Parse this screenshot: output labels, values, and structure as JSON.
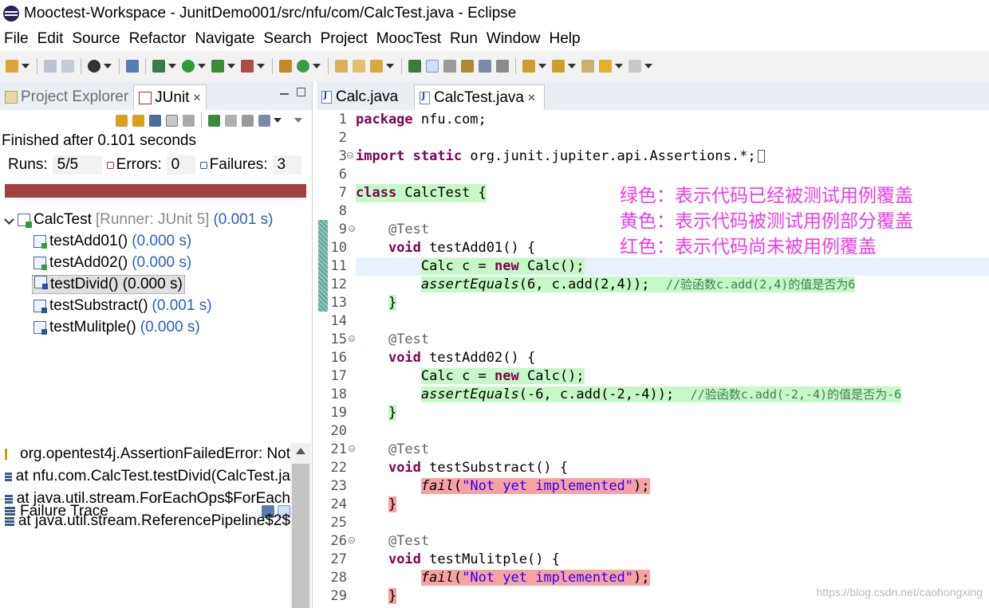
{
  "window": {
    "title": "Mooctest-Workspace - JunitDemo001/src/nfu/com/CalcTest.java - Eclipse"
  },
  "menu": [
    "File",
    "Edit",
    "Source",
    "Refactor",
    "Navigate",
    "Search",
    "Project",
    "MoocTest",
    "Run",
    "Window",
    "Help"
  ],
  "left_panel": {
    "tabs": [
      {
        "label": "Project Explorer"
      },
      {
        "label": "JUnit"
      }
    ],
    "status": "Finished after 0.101 seconds",
    "counters": {
      "runs_label": "Runs:",
      "runs": "5/5",
      "errors_label": "Errors:",
      "errors": "0",
      "failures_label": "Failures:",
      "failures": "3"
    },
    "progress_color": "#a04040",
    "tree": {
      "root": {
        "name": "CalcTest",
        "runner": "[Runner: JUnit 5]",
        "time": "(0.001 s)"
      },
      "children": [
        {
          "name": "testAdd01()",
          "time": "(0.000 s)"
        },
        {
          "name": "testAdd02()",
          "time": "(0.000 s)"
        },
        {
          "name": "testDivid()",
          "time": "(0.000 s)"
        },
        {
          "name": "testSubstract()",
          "time": "(0.001 s)"
        },
        {
          "name": "testMulitple()",
          "time": "(0.000 s)"
        }
      ]
    },
    "failure_trace": {
      "title": "Failure Trace",
      "lines": [
        "org.opentest4j.AssertionFailedError: Not",
        "at nfu.com.CalcTest.testDivid(CalcTest.ja",
        "at java.util.stream.ForEachOps$ForEach",
        "at java.util.stream.ReferencePipeline$2$"
      ]
    }
  },
  "editor": {
    "tabs": [
      {
        "label": "Calc.java"
      },
      {
        "label": "CalcTest.java"
      }
    ],
    "line_numbers": [
      "1",
      "2",
      "3",
      "6",
      "7",
      "8",
      "9",
      "10",
      "11",
      "12",
      "13",
      "14",
      "15",
      "16",
      "17",
      "18",
      "19",
      "20",
      "21",
      "22",
      "23",
      "24",
      "25",
      "26",
      "27",
      "28",
      "29"
    ],
    "legend": [
      "绿色：表示代码已经被测试用例覆盖",
      "黄色：表示代码被测试用例部分覆盖",
      "红色：表示代码尚未被用例覆盖"
    ],
    "legend_color": "#e83ce8",
    "coverage_colors": {
      "covered": "#c6f7c6",
      "not_covered": "#f7a2a2"
    }
  },
  "watermark": "https://blog.csdn.net/caohongxing"
}
